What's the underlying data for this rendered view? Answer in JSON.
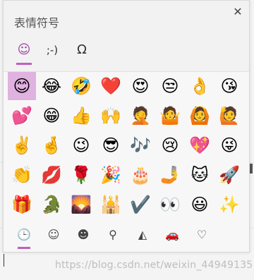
{
  "panel": {
    "title": "表情符号",
    "close_icon": "✕",
    "tabs": [
      {
        "label": "☺",
        "name": "emoji",
        "active": true
      },
      {
        "label": ";-)",
        "name": "kaomoji",
        "active": false
      },
      {
        "label": "Ω",
        "name": "symbols",
        "active": false
      }
    ],
    "emojis": [
      [
        "😊",
        "😂",
        "🤣",
        "❤️",
        "😍",
        "😒",
        "👌",
        "😘"
      ],
      [
        "💕",
        "😁",
        "👍",
        "🙌",
        "🤦",
        "🤷",
        "🙆",
        "🙋"
      ],
      [
        "✌️",
        "🤞",
        "😉",
        "😎",
        "🎶",
        "😢",
        "💖",
        "😜"
      ],
      [
        "👏",
        "💋",
        "🌹",
        "🎉",
        "🎂",
        "🤳",
        "🐱",
        "🚀"
      ],
      [
        "🎁",
        "🐊",
        "🌄",
        "🕌",
        "✔️",
        "👀",
        "😃",
        "✨"
      ]
    ],
    "categories": [
      {
        "label": "🕒",
        "name": "recent-icon",
        "active": true
      },
      {
        "label": "☺",
        "name": "smiley-icon",
        "active": false
      },
      {
        "label": "☻",
        "name": "people-icon",
        "active": false
      },
      {
        "label": "⚲",
        "name": "celebration-icon",
        "active": false
      },
      {
        "label": "◭",
        "name": "food-icon",
        "active": false
      },
      {
        "label": "🚗",
        "name": "travel-icon",
        "active": false
      },
      {
        "label": "♡",
        "name": "heart-icon",
        "active": false
      }
    ]
  },
  "watermark": "https://blog.csdn.net/weixin_44949135",
  "colors": {
    "accent": "#c060c0",
    "selected_bg": "#e0b2e0"
  }
}
